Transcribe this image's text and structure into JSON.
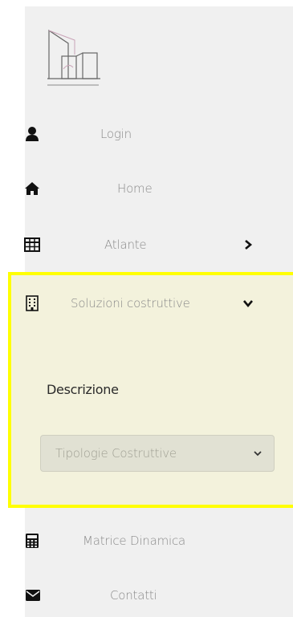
{
  "nav": {
    "items": [
      {
        "label": "Login",
        "icon": "user-icon"
      },
      {
        "label": "Home",
        "icon": "home-icon"
      },
      {
        "label": "Atlante",
        "icon": "table-icon"
      },
      {
        "label": "Soluzioni costruttive",
        "icon": "building-icon"
      },
      {
        "label": "Matrice Dinamica",
        "icon": "calculator-icon"
      },
      {
        "label": "Contatti",
        "icon": "envelope-icon"
      }
    ]
  },
  "submenu": {
    "description_label": "Descrizione",
    "select_value": "Tipologie Costruttive"
  },
  "colors": {
    "highlight_border": "#ffff00",
    "highlight_bg": "#f3f2dc",
    "sidebar_bg": "#f0f0f0"
  }
}
